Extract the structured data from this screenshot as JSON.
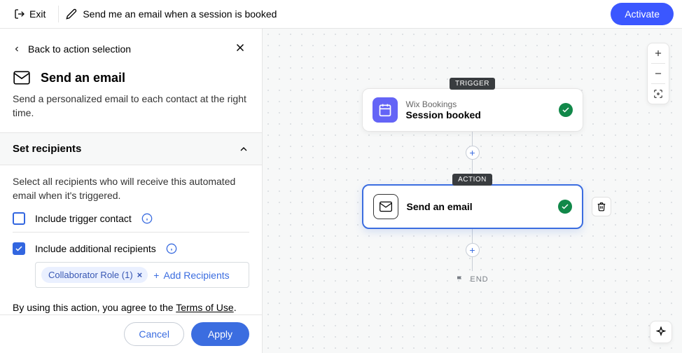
{
  "header": {
    "exit": "Exit",
    "title": "Send me an email when a session is booked",
    "activate": "Activate"
  },
  "panel": {
    "back": "Back to action selection",
    "heading": "Send an email",
    "desc": "Send a personalized email to each contact at the right time.",
    "section_title": "Set recipients",
    "section_desc": "Select all recipients who will receive this automated email when it's triggered.",
    "include_trigger": "Include trigger contact",
    "include_additional": "Include additional recipients",
    "chip": "Collaborator Role (1)",
    "add_recipients": "Add Recipients",
    "terms_prefix": "By using this action, you agree to the ",
    "terms_link": "Terms of Use"
  },
  "footer": {
    "cancel": "Cancel",
    "apply": "Apply"
  },
  "flow": {
    "trigger_tag": "TRIGGER",
    "trigger_sub": "Wix Bookings",
    "trigger_title": "Session booked",
    "action_tag": "ACTION",
    "action_title": "Send an email",
    "end": "END"
  },
  "colors": {
    "accent": "#3b6de0",
    "success": "#118849"
  }
}
